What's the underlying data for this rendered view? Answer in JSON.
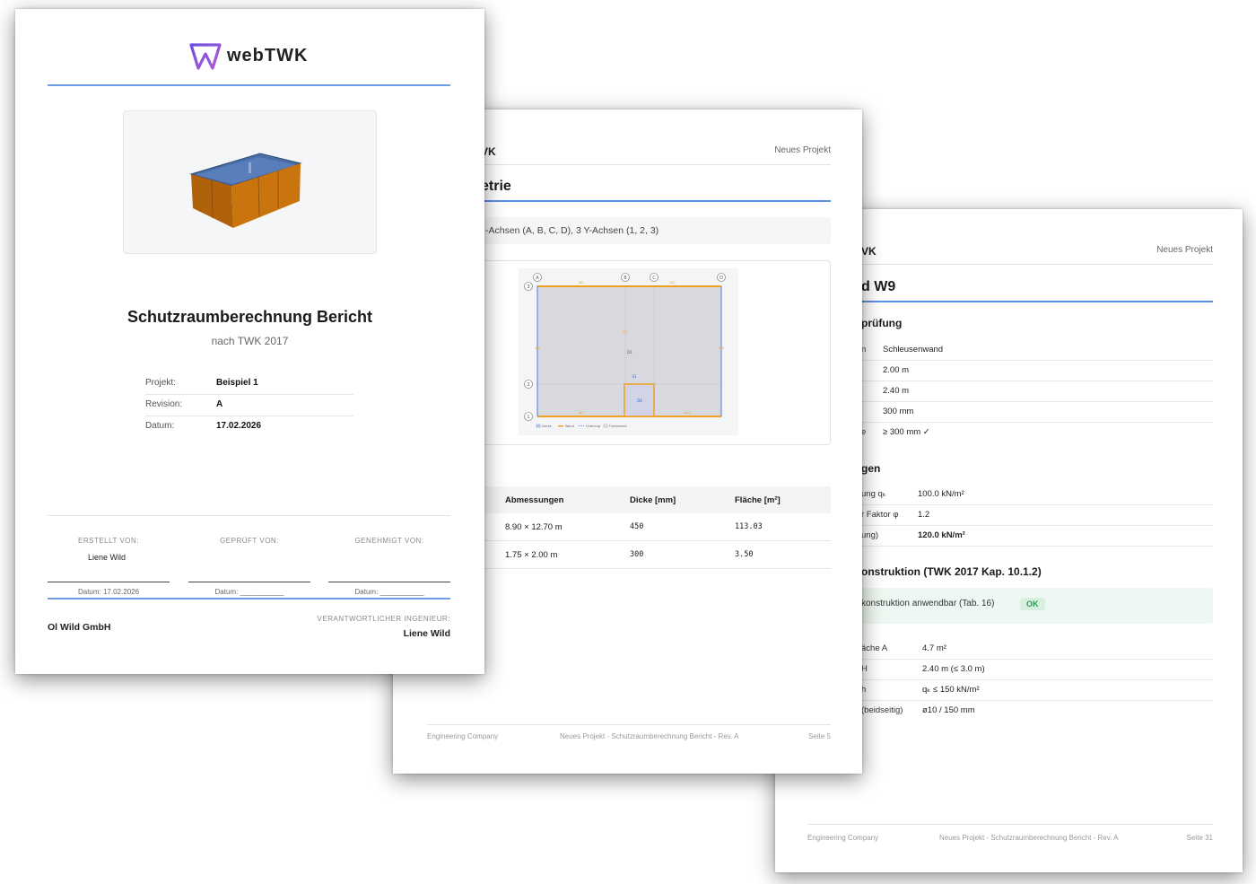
{
  "cover": {
    "brand": "webTWK",
    "title": "Schutzraumberechnung Bericht",
    "subtitle": "nach TWK 2017",
    "info": [
      {
        "label": "Projekt:",
        "value": "Beispiel 1"
      },
      {
        "label": "Revision:",
        "value": "A"
      },
      {
        "label": "Datum:",
        "value": "17.02.2026"
      }
    ],
    "signatures": [
      {
        "label": "ERSTELLT VON:",
        "name": "Liene Wild",
        "date": "Datum: 17.02.2026"
      },
      {
        "label": "GEPRÜFT VON:",
        "name": "",
        "date": "Datum: ___________"
      },
      {
        "label": "GENEHMIGT VON:",
        "name": "",
        "date": "Datum: ___________"
      }
    ],
    "company": "Ol Wild GmbH",
    "engineer_label": "VERANTWORTLICHER INGENIEUR:",
    "engineer_name": "Liene Wild"
  },
  "page5": {
    "header_left": "VK",
    "header_right": "Neues Projekt",
    "title": "etrie",
    "axes_text": "-Achsen (A, B, C, D), 3 Y-Achsen (1, 2, 3)",
    "plan": {
      "x_axes": [
        "A",
        "B",
        "C",
        "D"
      ],
      "y_axes": [
        "3",
        "2",
        "1"
      ],
      "labels": [
        "W1",
        "W2",
        "W3",
        "W4",
        "W5",
        "W6",
        "D1",
        "S1",
        "D4"
      ],
      "legend": [
        "Decke",
        "Wand",
        "Unterzug",
        "Fundament"
      ]
    },
    "table": {
      "headers": [
        "Abmessungen",
        "Dicke [mm]",
        "Fläche [m²]"
      ],
      "rows": [
        [
          "8.90 × 12.70 m",
          "450",
          "113.03"
        ],
        [
          "1.75 × 2.00 m",
          "300",
          "3.50"
        ]
      ]
    },
    "footer": {
      "left": "Engineering Company",
      "center": "Neues Projekt - Schutzraumberechnung Bericht - Rev. A",
      "right": "Seite 5"
    }
  },
  "page31": {
    "header_left": "VK",
    "header_right": "Neues Projekt",
    "title": "d W9",
    "section1": "prüfung",
    "rows1": [
      {
        "k": "n",
        "v": "Schleusenwand"
      },
      {
        "k": "",
        "v": "2.00 m"
      },
      {
        "k": "",
        "v": "2.40 m"
      },
      {
        "k": "",
        "v": "300 mm"
      },
      {
        "k": "e",
        "v": "≥ 300 mm ✓"
      }
    ],
    "section2": "gen",
    "rows2": [
      {
        "k": "ung qₖ",
        "v": "100.0 kN/m²"
      },
      {
        "k": "r Faktor φ",
        "v": "1.2"
      },
      {
        "k": "ung)",
        "v": "120.0 kN/m²"
      }
    ],
    "section3": "onstruktion (TWK 2017 Kap. 10.1.2)",
    "ok_text": "konstruktion anwendbar (Tab. 16)",
    "ok_badge": "OK",
    "rows3": [
      {
        "k": "äche A",
        "v": "4.7 m²"
      },
      {
        "k": "H",
        "v": "2.40 m (≤ 3.0 m)"
      },
      {
        "k": "h",
        "v": "qₖ ≤ 150 kN/m²"
      },
      {
        "k": "(beidseitig)",
        "v": "ø10 / 150 mm"
      }
    ],
    "footer": {
      "left": "Engineering Company",
      "center": "Neues Projekt - Schutzraumberechnung Bericht - Rev. A",
      "right": "Seite 31"
    }
  },
  "colors": {
    "accent_blue": "#5b8fe6",
    "ok_green": "#2f9a57",
    "wall_orange": "#f0a020",
    "logo_purple": "#8a4fd8"
  }
}
